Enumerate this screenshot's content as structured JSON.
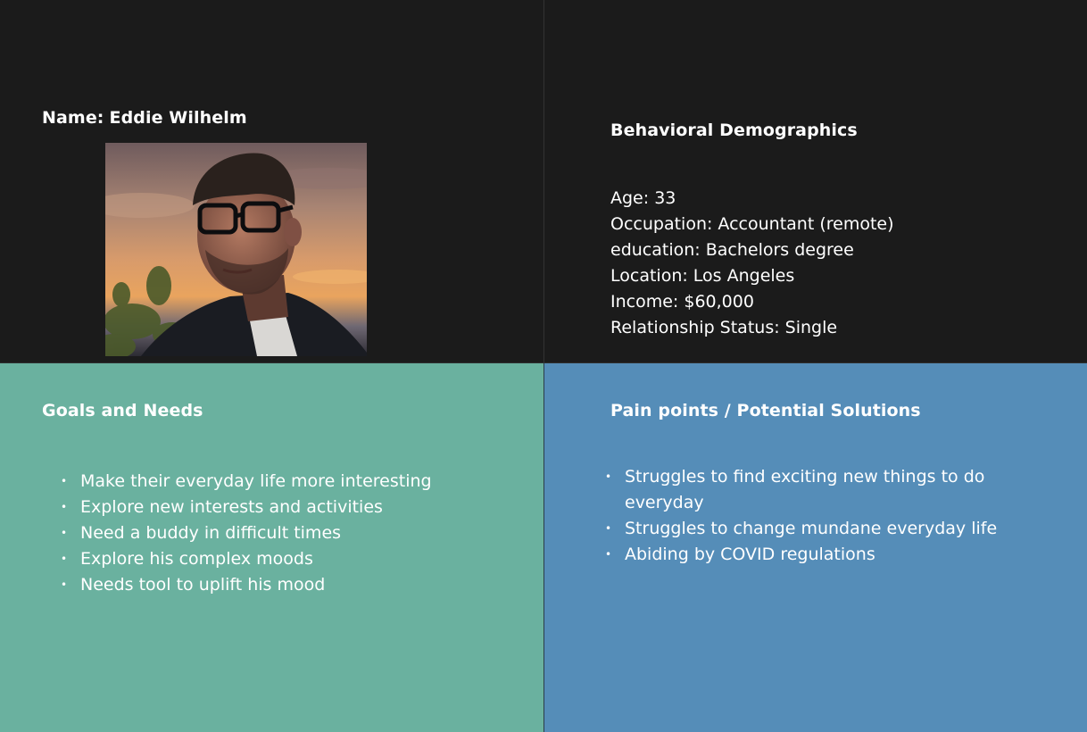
{
  "profile": {
    "name_label": "Name:",
    "name_value": "Eddie Wilhelm",
    "photo_alt": "Portrait of a young man with glasses at sunset"
  },
  "demographics": {
    "title": "Behavioral Demographics",
    "items": [
      "Age: 33",
      "Occupation: Accountant (remote)",
      "education: Bachelors degree",
      "Location: Los Angeles",
      "Income: $60,000",
      "Relationship Status: Single"
    ]
  },
  "goals": {
    "title": "Goals and Needs",
    "bullet": "•",
    "items": [
      "Make their everyday life more interesting",
      "Explore new interests and activities",
      "Need a buddy in difficult times",
      "Explore his complex moods",
      "Needs tool to uplift his mood"
    ]
  },
  "pain": {
    "title": "Pain points / Potential Solutions",
    "bullet": "•",
    "items": [
      "Struggles to find exciting new things to do everyday",
      "Struggles to change mundane everyday life",
      "Abiding by COVID regulations"
    ]
  },
  "colors": {
    "dark_panel": "#1b1b1b",
    "goals_panel": "#6ab19f",
    "pain_panel": "#558db8",
    "text": "#ffffff"
  }
}
